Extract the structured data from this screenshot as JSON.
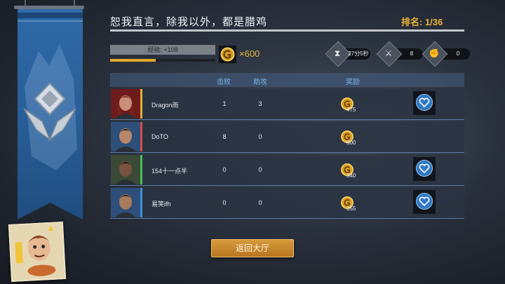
{
  "header": {
    "title": "恕我直言，除我以外，都是腊鸡",
    "rank": "排名: 1/36"
  },
  "exp": {
    "label": "经验: +108",
    "progress": 0.43
  },
  "coins": {
    "amount": "×600"
  },
  "stats": {
    "time": "27分5秒",
    "kills": "8",
    "assists": "0"
  },
  "table": {
    "columns": [
      "击败",
      "助攻",
      "奖励"
    ],
    "rows": [
      {
        "name": "Dragon雨",
        "kills": "1",
        "assists": "3",
        "reward": "475",
        "bar_color": "#e0b02e",
        "has_like": true
      },
      {
        "name": "DoTO",
        "kills": "8",
        "assists": "0",
        "reward": "600",
        "bar_color": "#d64b4b",
        "has_like": false
      },
      {
        "name": "154十一点半",
        "kills": "0",
        "assists": "0",
        "reward": "340",
        "bar_color": "#4cbd56",
        "has_like": true
      },
      {
        "name": "易笑ifh",
        "kills": "0",
        "assists": "0",
        "reward": "355",
        "bar_color": "#3d8fd8",
        "has_like": true
      }
    ]
  },
  "buttons": {
    "return": "返回大厅"
  },
  "colors": {
    "accent": "#e6b33c",
    "header_blue": "#79b6ea",
    "banner": "#2f6aa8"
  },
  "icons": {
    "time": "hourglass-icon",
    "kills": "sword-icon",
    "assists": "fist-icon",
    "coin": "coin-icon",
    "like": "heart-icon",
    "rank": "rank-emblem-icon"
  }
}
